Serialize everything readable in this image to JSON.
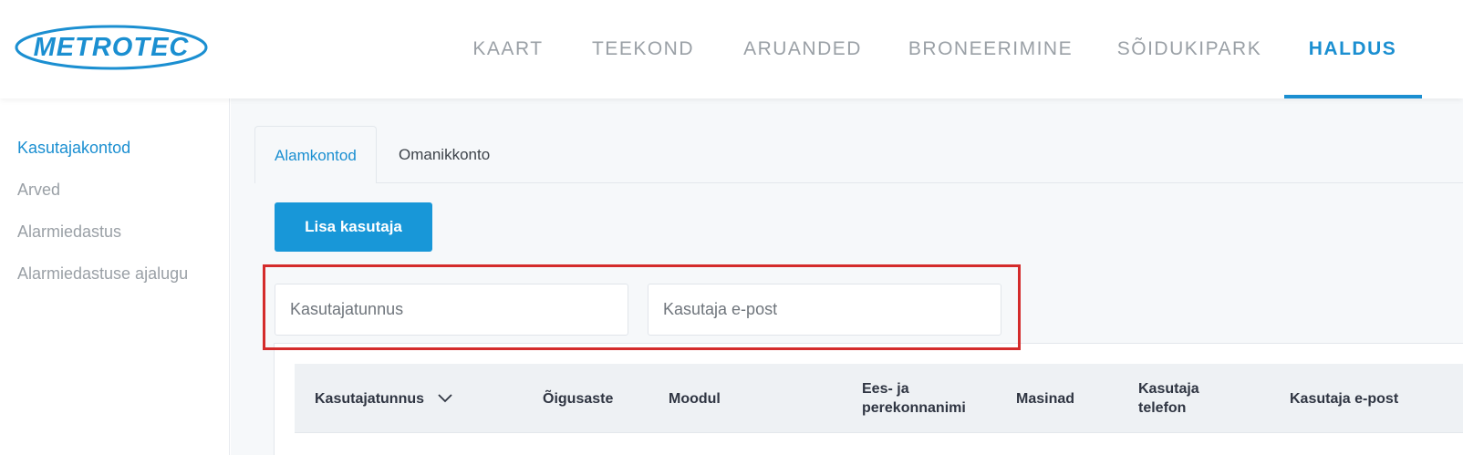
{
  "app": {
    "logo_text": "METROTEC",
    "brand_color": "#1b8fd1"
  },
  "nav": {
    "items": [
      {
        "label": "KAART"
      },
      {
        "label": "TEEKOND"
      },
      {
        "label": "ARUANDED"
      },
      {
        "label": "BRONEERIMINE"
      },
      {
        "label": "SÕIDUKIPARK"
      },
      {
        "label": "HALDUS",
        "active": true
      }
    ]
  },
  "sidebar": {
    "items": [
      {
        "label": "Kasutajakontod",
        "active": true
      },
      {
        "label": "Arved"
      },
      {
        "label": "Alarmiedastus"
      },
      {
        "label": "Alarmiedastuse ajalugu"
      }
    ]
  },
  "main": {
    "tabs": [
      {
        "label": "Alamkontod",
        "active": true
      },
      {
        "label": "Omanikkonto"
      }
    ],
    "add_button_label": "Lisa kasutaja",
    "filters": {
      "username_placeholder": "Kasutajatunnus",
      "username_value": "",
      "email_placeholder": "Kasutaja e-post",
      "email_value": ""
    },
    "table": {
      "columns": [
        {
          "label": "Kasutajatunnus",
          "sort_icon": "chevron-down-icon"
        },
        {
          "label": "Õigusaste"
        },
        {
          "label": "Moodul"
        },
        {
          "label_line1": "Ees- ja",
          "label_line2": "perekonnanimi"
        },
        {
          "label": "Masinad"
        },
        {
          "label_line1": "Kasutaja",
          "label_line2": "telefon"
        },
        {
          "label": "Kasutaja e-post"
        }
      ]
    }
  },
  "colors": {
    "accent": "#1b8fd1",
    "button": "#1897d8",
    "highlight_border": "#d42b2b"
  }
}
